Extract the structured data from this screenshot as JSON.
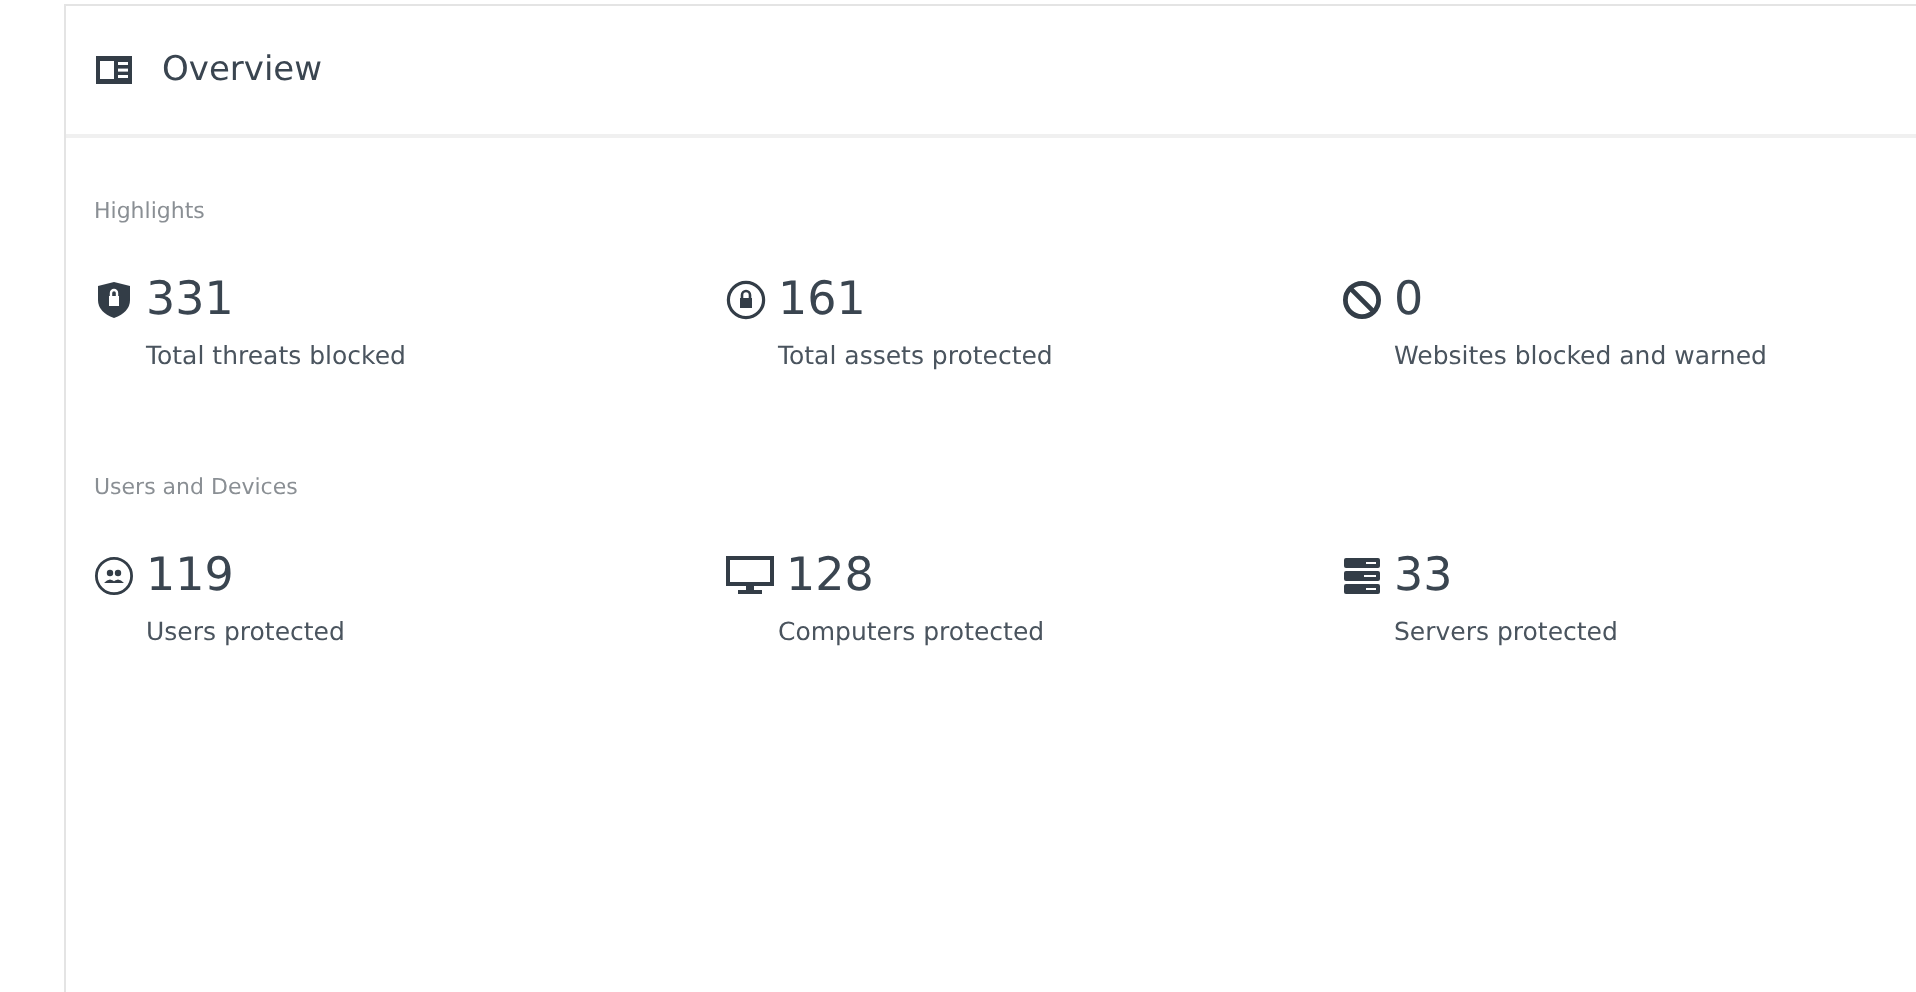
{
  "header": {
    "title": "Overview"
  },
  "sections": [
    {
      "title": "Highlights",
      "stats": [
        {
          "kind": "shield",
          "value": "331",
          "label": "Total threats blocked"
        },
        {
          "kind": "lock",
          "value": "161",
          "label": "Total assets protected"
        },
        {
          "kind": "block",
          "value": "0",
          "label": "Websites blocked and warned"
        }
      ]
    },
    {
      "title": "Users and Devices",
      "stats": [
        {
          "kind": "users",
          "value": "119",
          "label": "Users protected"
        },
        {
          "kind": "monitor",
          "value": "128",
          "label": "Computers protected"
        },
        {
          "kind": "server",
          "value": "33",
          "label": "Servers protected"
        }
      ]
    }
  ]
}
